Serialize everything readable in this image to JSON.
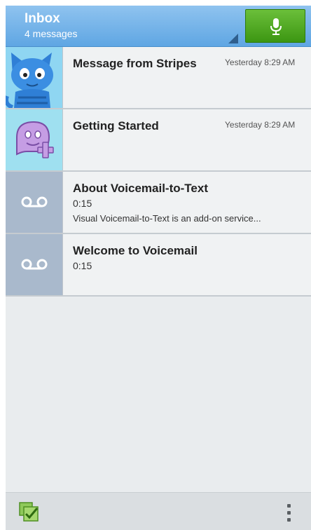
{
  "header": {
    "title": "Inbox",
    "subtitle": "4 messages",
    "mic_icon": "microphone-icon",
    "accent": "#5fa6e3",
    "mic_color": "#4aa71f"
  },
  "messages": [
    {
      "title": "Message from Stripes",
      "time": "Yesterday 8:29 AM",
      "duration": "",
      "preview": "",
      "thumb": "cat-avatar"
    },
    {
      "title": "Getting Started",
      "time": "Yesterday 8:29 AM",
      "duration": "",
      "preview": "",
      "thumb": "add-contact-avatar"
    },
    {
      "title": "About Voicemail-to-Text",
      "time": "",
      "duration": "0:15",
      "preview": "Visual Voicemail-to-Text is an add-on service...",
      "thumb": "voicemail-icon"
    },
    {
      "title": "Welcome to Voicemail",
      "time": "",
      "duration": "0:15",
      "preview": "",
      "thumb": "voicemail-icon"
    }
  ],
  "bottom_bar": {
    "select_icon": "select-all-icon",
    "menu_icon": "more-vert-icon"
  }
}
